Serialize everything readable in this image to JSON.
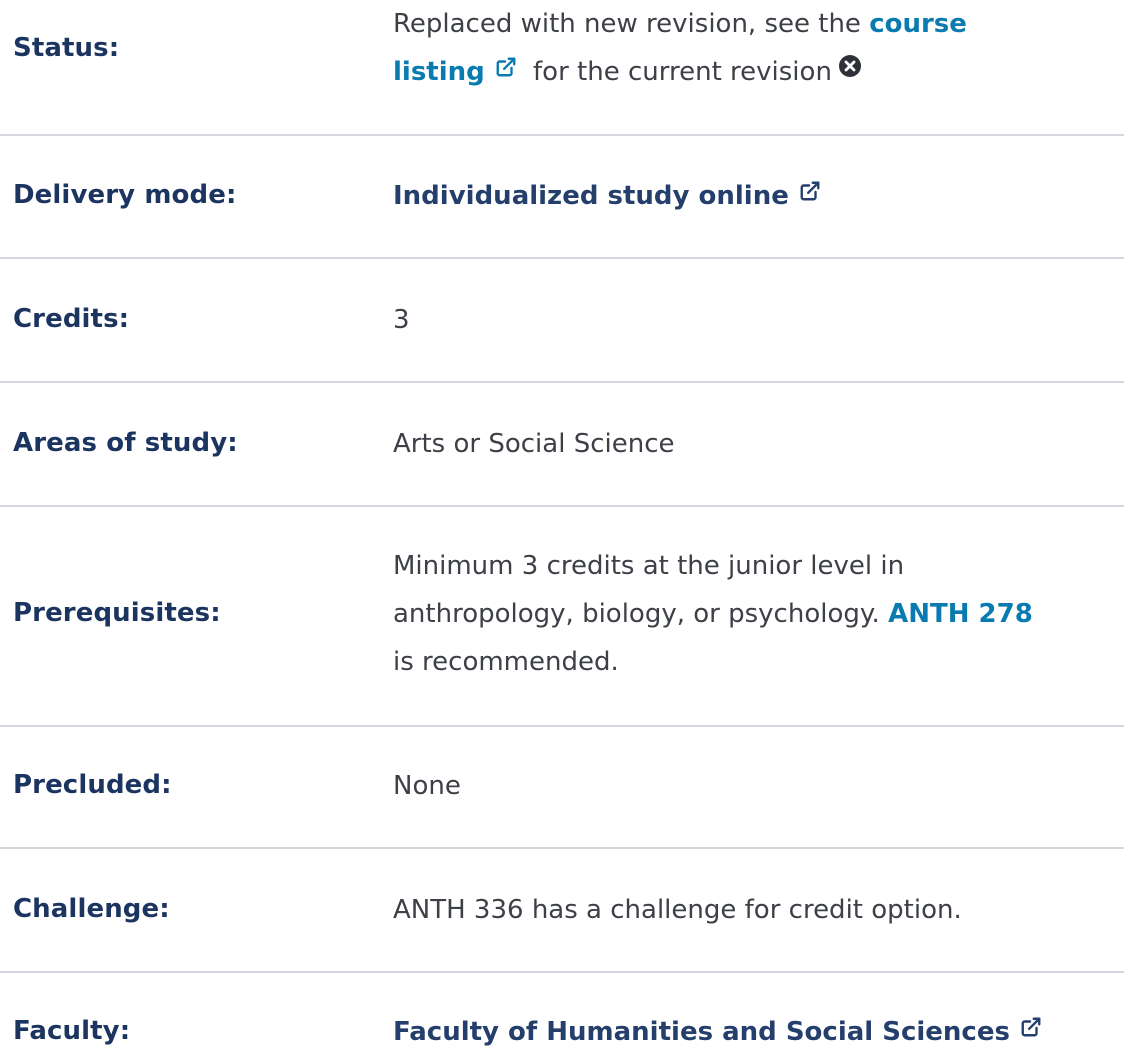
{
  "rows": [
    {
      "label": "Status:",
      "value_prefix": "Replaced with new revision, see the ",
      "link_text_1": "course",
      "link_text_2": "listing",
      "value_suffix": " for the current revision"
    },
    {
      "label": "Delivery mode:",
      "value": "Individualized study online"
    },
    {
      "label": "Credits:",
      "value": "3"
    },
    {
      "label": "Areas of study:",
      "value": "Arts or Social Science"
    },
    {
      "label": "Prerequisites:",
      "line1": "Minimum 3 credits at the junior level in",
      "line2_prefix": "anthropology, biology, or psychology. ",
      "line2_link": "ANTH 278",
      "line3": "is recommended."
    },
    {
      "label": "Precluded:",
      "value": "None"
    },
    {
      "label": "Challenge:",
      "value": "ANTH 336 has a challenge for credit option."
    },
    {
      "label": "Faculty:",
      "value": "Faculty of Humanities and Social Sciences"
    }
  ],
  "icons": {
    "external_link": "external-link-icon",
    "close_circle": "close-circle-icon"
  },
  "colors": {
    "label": "#1b3560",
    "link": "#0a7bb0",
    "link_dark": "#253f6d",
    "text": "#3d4047",
    "divider": "#d4d7dd"
  }
}
